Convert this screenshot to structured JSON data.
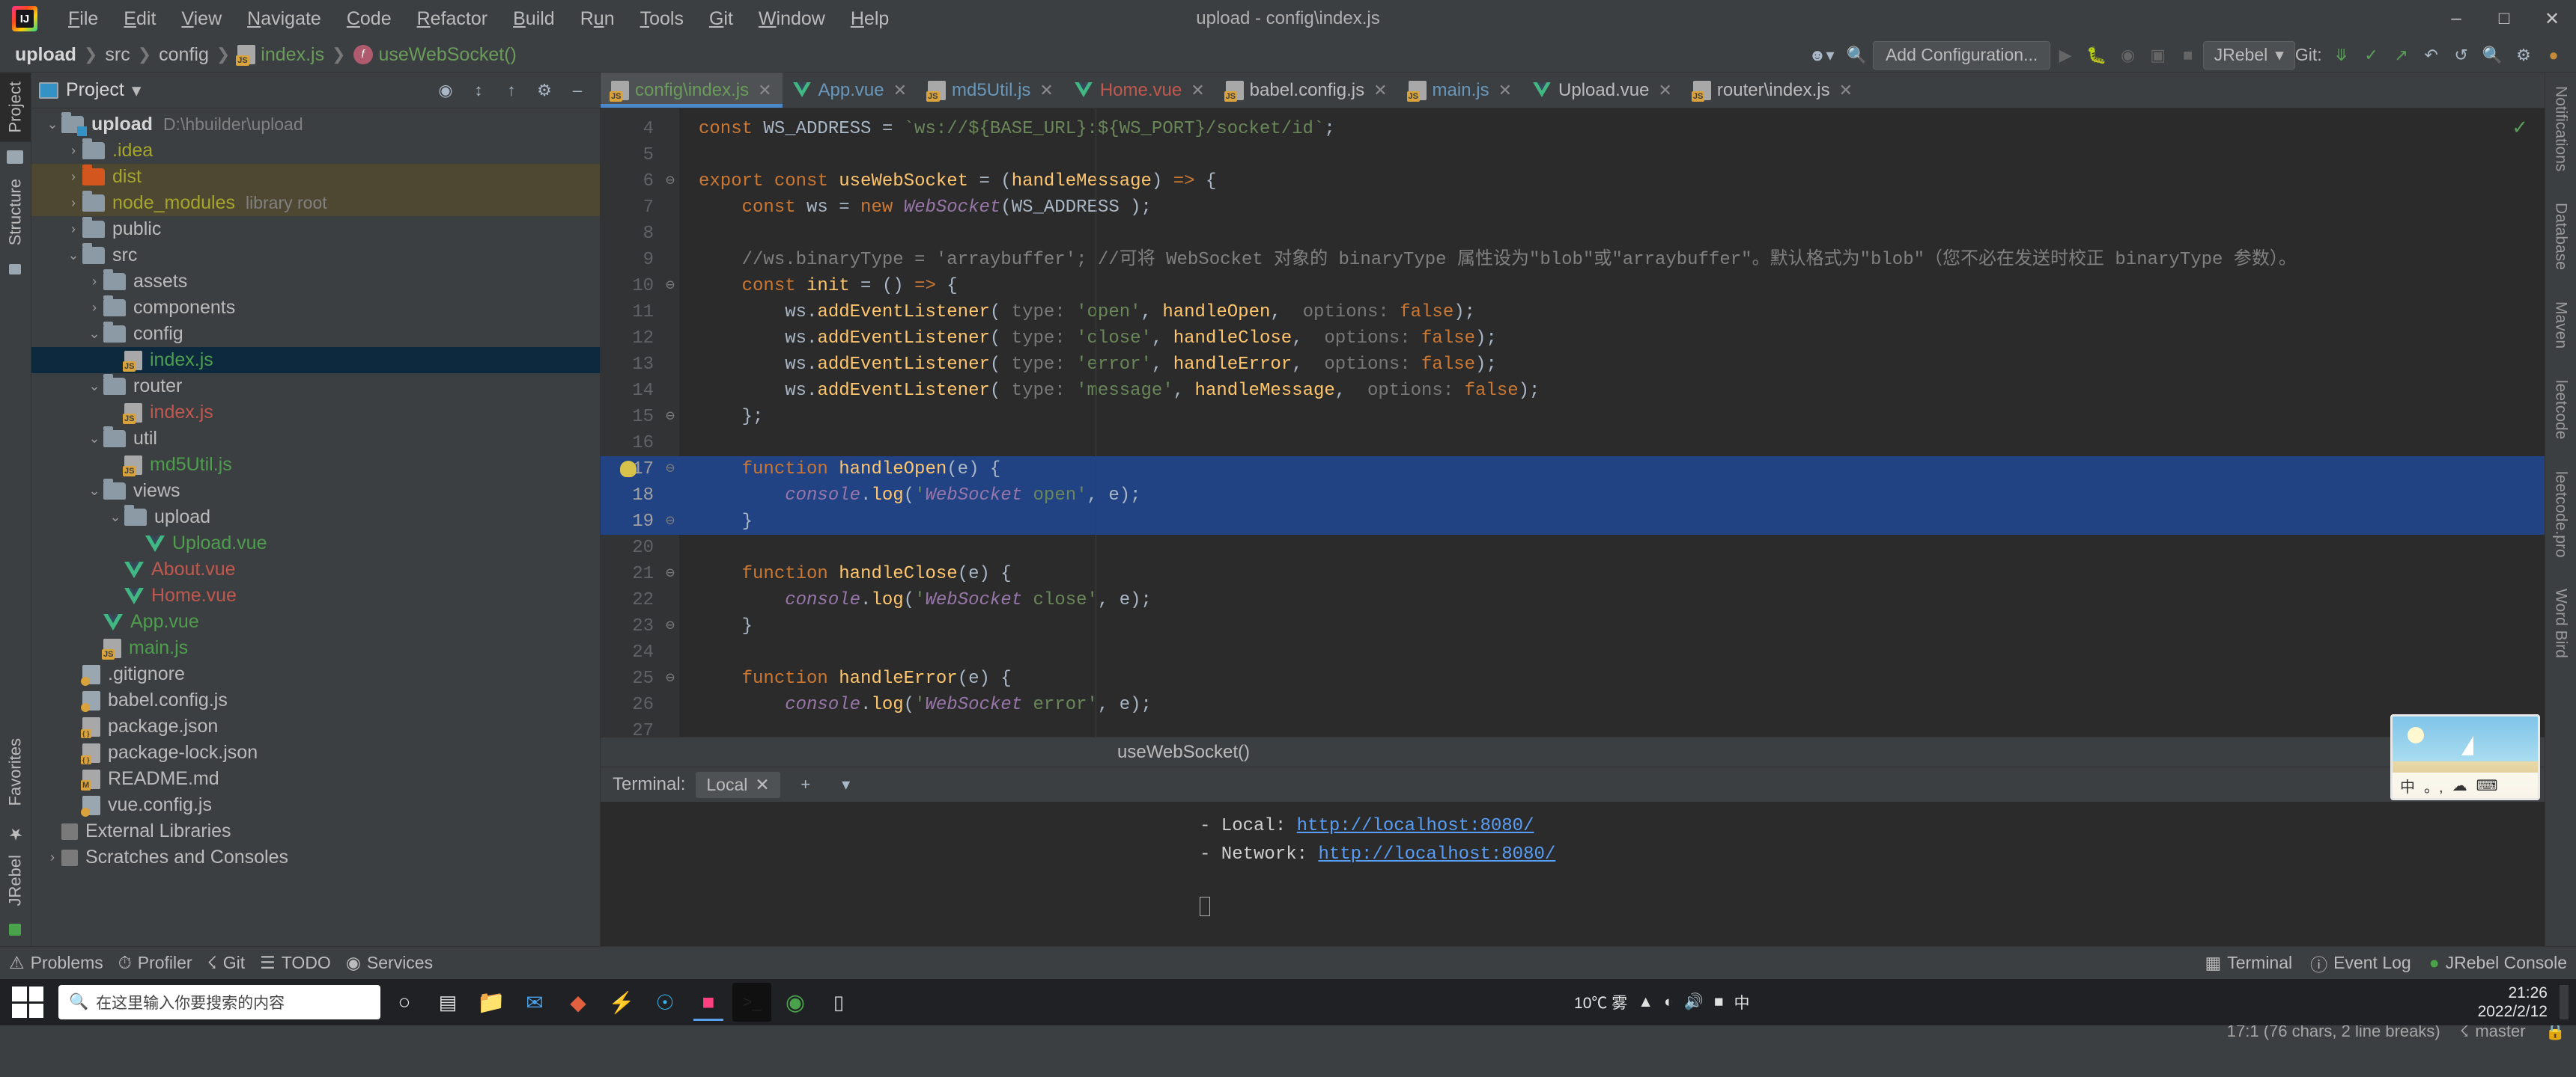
{
  "window": {
    "title": "upload - config\\index.js",
    "controls": [
      "–",
      "□",
      "✕"
    ]
  },
  "menubar": {
    "logo": "ij-logo",
    "items": [
      "File",
      "Edit",
      "View",
      "Navigate",
      "Code",
      "Refactor",
      "Build",
      "Run",
      "Tools",
      "Git",
      "Window",
      "Help"
    ]
  },
  "navbar": {
    "breadcrumb": [
      "upload",
      "src",
      "config",
      "index.js",
      "useWebSocket()"
    ],
    "separator": "❯",
    "run_config": "Add Configuration...",
    "jrebel": "JRebel",
    "git_label": "Git:",
    "icons": [
      "user-avatar-icon",
      "search-everywhere-icon",
      "run-icon",
      "debug-icon",
      "coverage-icon",
      "profiler-icon",
      "stop-icon",
      "git-update-icon",
      "commit-icon",
      "push-icon",
      "history-icon",
      "rollback-icon",
      "search-icon",
      "settings-icon",
      "notifications-icon"
    ]
  },
  "left_strips": {
    "top": [
      "Project",
      "Structure"
    ],
    "bottom": [
      "Favorites",
      "JRebel"
    ]
  },
  "project_panel": {
    "title": "Project",
    "tree": [
      {
        "indent": 0,
        "arrow": "⌄",
        "icon": "module-folder",
        "label": "upload",
        "style": "bold",
        "extra": "D:\\hbuilder\\upload"
      },
      {
        "indent": 1,
        "arrow": "›",
        "icon": "folder",
        "label": ".idea",
        "style": "yellow",
        "extra": ""
      },
      {
        "indent": 1,
        "arrow": "›",
        "icon": "folder-orange",
        "label": "dist",
        "style": "yellow",
        "extra": "",
        "row": "hl"
      },
      {
        "indent": 1,
        "arrow": "›",
        "icon": "folder",
        "label": "node_modules",
        "style": "yellow",
        "extra": "library root",
        "row": "hl"
      },
      {
        "indent": 1,
        "arrow": "›",
        "icon": "folder",
        "label": "public",
        "style": "white",
        "extra": ""
      },
      {
        "indent": 1,
        "arrow": "⌄",
        "icon": "folder",
        "label": "src",
        "style": "white",
        "extra": ""
      },
      {
        "indent": 2,
        "arrow": "›",
        "icon": "folder",
        "label": "assets",
        "style": "white",
        "extra": ""
      },
      {
        "indent": 2,
        "arrow": "›",
        "icon": "folder",
        "label": "components",
        "style": "white",
        "extra": ""
      },
      {
        "indent": 2,
        "arrow": "⌄",
        "icon": "folder",
        "label": "config",
        "style": "white",
        "extra": ""
      },
      {
        "indent": 3,
        "arrow": "",
        "icon": "js-file",
        "label": "index.js",
        "style": "green",
        "extra": "",
        "row": "sel"
      },
      {
        "indent": 2,
        "arrow": "⌄",
        "icon": "folder",
        "label": "router",
        "style": "white",
        "extra": ""
      },
      {
        "indent": 3,
        "arrow": "",
        "icon": "js-file",
        "label": "index.js",
        "style": "red",
        "extra": ""
      },
      {
        "indent": 2,
        "arrow": "⌄",
        "icon": "folder",
        "label": "util",
        "style": "white",
        "extra": ""
      },
      {
        "indent": 3,
        "arrow": "",
        "icon": "js-file",
        "label": "md5Util.js",
        "style": "green",
        "extra": ""
      },
      {
        "indent": 2,
        "arrow": "⌄",
        "icon": "folder",
        "label": "views",
        "style": "white",
        "extra": ""
      },
      {
        "indent": 3,
        "arrow": "⌄",
        "icon": "folder",
        "label": "upload",
        "style": "white",
        "extra": ""
      },
      {
        "indent": 4,
        "arrow": "",
        "icon": "vue-file",
        "label": "Upload.vue",
        "style": "green",
        "extra": ""
      },
      {
        "indent": 3,
        "arrow": "",
        "icon": "vue-file",
        "label": "About.vue",
        "style": "red",
        "extra": ""
      },
      {
        "indent": 3,
        "arrow": "",
        "icon": "vue-file",
        "label": "Home.vue",
        "style": "red",
        "extra": ""
      },
      {
        "indent": 2,
        "arrow": "",
        "icon": "vue-file",
        "label": "App.vue",
        "style": "green",
        "extra": ""
      },
      {
        "indent": 2,
        "arrow": "",
        "icon": "js-file",
        "label": "main.js",
        "style": "green",
        "extra": ""
      },
      {
        "indent": 1,
        "arrow": "",
        "icon": "gear-file",
        "label": ".gitignore",
        "style": "white",
        "extra": ""
      },
      {
        "indent": 1,
        "arrow": "",
        "icon": "gear-file",
        "label": "babel.config.js",
        "style": "white",
        "extra": ""
      },
      {
        "indent": 1,
        "arrow": "",
        "icon": "json-file",
        "label": "package.json",
        "style": "white",
        "extra": ""
      },
      {
        "indent": 1,
        "arrow": "",
        "icon": "json-file",
        "label": "package-lock.json",
        "style": "white",
        "extra": ""
      },
      {
        "indent": 1,
        "arrow": "",
        "icon": "md-file",
        "label": "README.md",
        "style": "white",
        "extra": ""
      },
      {
        "indent": 1,
        "arrow": "",
        "icon": "gear-file",
        "label": "vue.config.js",
        "style": "white",
        "extra": ""
      },
      {
        "indent": 0,
        "arrow": "",
        "icon": "library-icon",
        "label": "External Libraries",
        "style": "white",
        "extra": ""
      },
      {
        "indent": 0,
        "arrow": "›",
        "icon": "scratch-icon",
        "label": "Scratches and Consoles",
        "style": "white",
        "extra": ""
      }
    ]
  },
  "editor": {
    "tabs": [
      {
        "label": "config\\index.js",
        "icon": "js-file",
        "color": "green",
        "active": true
      },
      {
        "label": "App.vue",
        "icon": "vue-file",
        "color": "blue",
        "active": false
      },
      {
        "label": "md5Util.js",
        "icon": "js-file",
        "color": "blue",
        "active": false
      },
      {
        "label": "Home.vue",
        "icon": "vue-file",
        "color": "red",
        "active": false
      },
      {
        "label": "babel.config.js",
        "icon": "gear-file",
        "color": "plain",
        "active": false
      },
      {
        "label": "main.js",
        "icon": "js-file",
        "color": "blue",
        "active": false
      },
      {
        "label": "Upload.vue",
        "icon": "vue-file",
        "color": "plain",
        "active": false
      },
      {
        "label": "router\\index.js",
        "icon": "js-file",
        "color": "plain",
        "active": false
      }
    ],
    "first_line": 4,
    "lines": [
      {
        "n": 4,
        "text": "const WS_ADDRESS = `ws://${BASE_URL}:${WS_PORT}/socket/id`;"
      },
      {
        "n": 5,
        "text": ""
      },
      {
        "n": 6,
        "text": "export const useWebSocket = (handleMessage) => {"
      },
      {
        "n": 7,
        "text": "    const ws = new WebSocket(WS_ADDRESS );"
      },
      {
        "n": 8,
        "text": ""
      },
      {
        "n": 9,
        "text": "    //ws.binaryType = 'arraybuffer'; //可将 WebSocket 对象的 binaryType 属性设为\"blob\"或\"arraybuffer\"。默认格式为\"blob\"（您不必在发送时校正 binaryType 参数）。"
      },
      {
        "n": 10,
        "text": "    const init = () => {"
      },
      {
        "n": 11,
        "text": "        ws.addEventListener( type: 'open', handleOpen,  options: false);"
      },
      {
        "n": 12,
        "text": "        ws.addEventListener( type: 'close', handleClose,  options: false);"
      },
      {
        "n": 13,
        "text": "        ws.addEventListener( type: 'error', handleError,  options: false);"
      },
      {
        "n": 14,
        "text": "        ws.addEventListener( type: 'message', handleMessage,  options: false);"
      },
      {
        "n": 15,
        "text": "    };"
      },
      {
        "n": 16,
        "text": ""
      },
      {
        "n": 17,
        "text": "    function handleOpen(e) {"
      },
      {
        "n": 18,
        "text": "        console.log('WebSocket open', e);"
      },
      {
        "n": 19,
        "text": "    }"
      },
      {
        "n": 20,
        "text": ""
      },
      {
        "n": 21,
        "text": "    function handleClose(e) {"
      },
      {
        "n": 22,
        "text": "        console.log('WebSocket close', e);"
      },
      {
        "n": 23,
        "text": "    }"
      },
      {
        "n": 24,
        "text": ""
      },
      {
        "n": 25,
        "text": "    function handleError(e) {"
      },
      {
        "n": 26,
        "text": "        console.log('WebSocket error', e);"
      },
      {
        "n": 27,
        "text": ""
      }
    ],
    "selected_lines": [
      17,
      18,
      19
    ],
    "breadcrumb_footer": "useWebSocket()"
  },
  "terminal": {
    "label": "Terminal:",
    "tab": "Local",
    "add_label": "+",
    "lines": [
      {
        "prefix": "  - Local:  ",
        "link": "http://localhost:8080/"
      },
      {
        "prefix": "  - Network:",
        "link": "http://localhost:8080/"
      }
    ]
  },
  "statusbar": {
    "left_items": [
      {
        "icon": "problems-icon",
        "label": "Problems"
      },
      {
        "icon": "profiler-icon",
        "label": "Profiler"
      },
      {
        "icon": "git-icon",
        "label": "Git"
      },
      {
        "icon": "todo-icon",
        "label": "TODO"
      },
      {
        "icon": "services-icon",
        "label": "Services"
      }
    ],
    "right_items": [
      {
        "icon": "terminal-icon",
        "label": "Terminal"
      },
      {
        "icon": "event-log-icon",
        "label": "Event Log"
      },
      {
        "icon": "jrebel-icon",
        "label": "JRebel Console"
      }
    ],
    "caret_pos": "17:1 (76 chars, 2 line breaks)",
    "branch": "master",
    "lock": "lock-icon"
  },
  "right_strips": [
    "Notifications",
    "Database",
    "Maven",
    "leetcode",
    "leetcode.pro",
    "Word Bird"
  ],
  "taskbar": {
    "search_placeholder": "在这里输入你要搜索的内容",
    "icons": [
      "cortana-icon",
      "task-view-icon",
      "file-explorer-icon",
      "mail-icon",
      "store-icon",
      "flash-icon",
      "edge-icon",
      "idea-icon",
      "terminal-icon",
      "chrome-icon",
      "phone-icon"
    ],
    "weather": "10℃  雾",
    "time": "21:26",
    "date": "2022/2/12",
    "tray": [
      "network-icon",
      "volume-icon",
      "battery-icon",
      "ime-icon"
    ]
  },
  "float_image": {
    "ime_items": [
      "中",
      "。,",
      "☁",
      "⌨"
    ]
  }
}
